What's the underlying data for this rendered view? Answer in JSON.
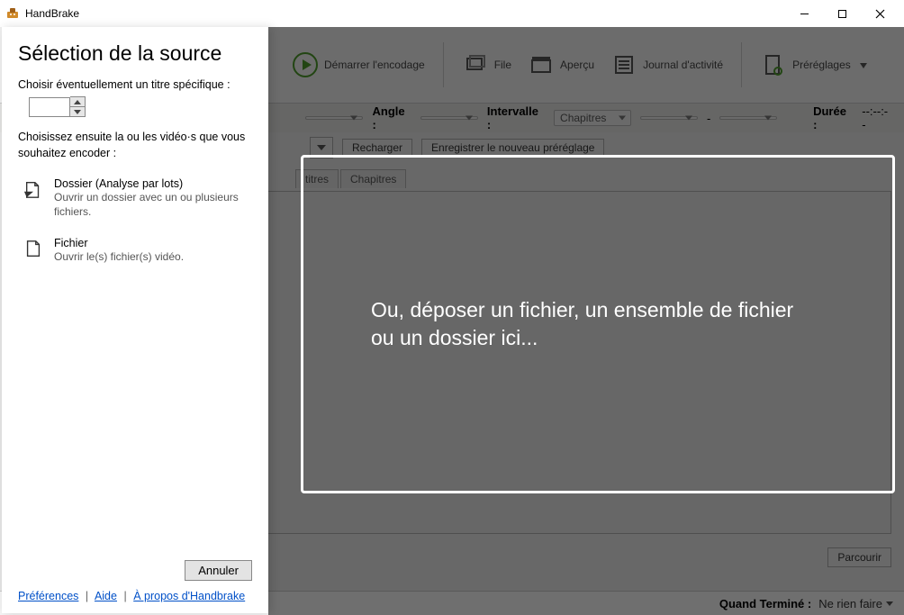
{
  "window": {
    "title": "HandBrake"
  },
  "toolbar": {
    "start": "Démarrer l'encodage",
    "file": "File",
    "preview": "Aperçu",
    "activity": "Journal d'activité",
    "presets": "Préréglages"
  },
  "params": {
    "angle_label": "Angle :",
    "interval_label": "Intervalle :",
    "interval_value": "Chapitres",
    "dash": "-",
    "duration_label": "Durée :",
    "duration_value": "--:--:--"
  },
  "preset_row": {
    "reload": "Recharger",
    "save_new": "Enregistrer le nouveau préréglage"
  },
  "tabs": {
    "subs": "titres",
    "chapters": "Chapitres"
  },
  "bottom": {
    "browse": "Parcourir"
  },
  "status": {
    "when_done_label": "Quand Terminé :",
    "when_done_value": "Ne rien faire"
  },
  "panel": {
    "heading": "Sélection de la source",
    "hint": "Choisir éventuellement un titre spécifique :",
    "hint2": "Choisissez ensuite la ou les vidéo·s que vous souhaitez encoder :",
    "opt_folder": {
      "title": "Dossier (Analyse par lots)",
      "desc": "Ouvrir un dossier avec un ou plusieurs fichiers."
    },
    "opt_file": {
      "title": "Fichier",
      "desc": "Ouvrir le(s) fichier(s) vidéo."
    },
    "cancel": "Annuler",
    "links": {
      "prefs": "Préférences",
      "help": "Aide",
      "about": "À propos d'Handbrake"
    }
  },
  "dropzone": {
    "line1": "Ou, déposer un fichier, un ensemble de fichier",
    "line2": "ou un dossier ici..."
  }
}
